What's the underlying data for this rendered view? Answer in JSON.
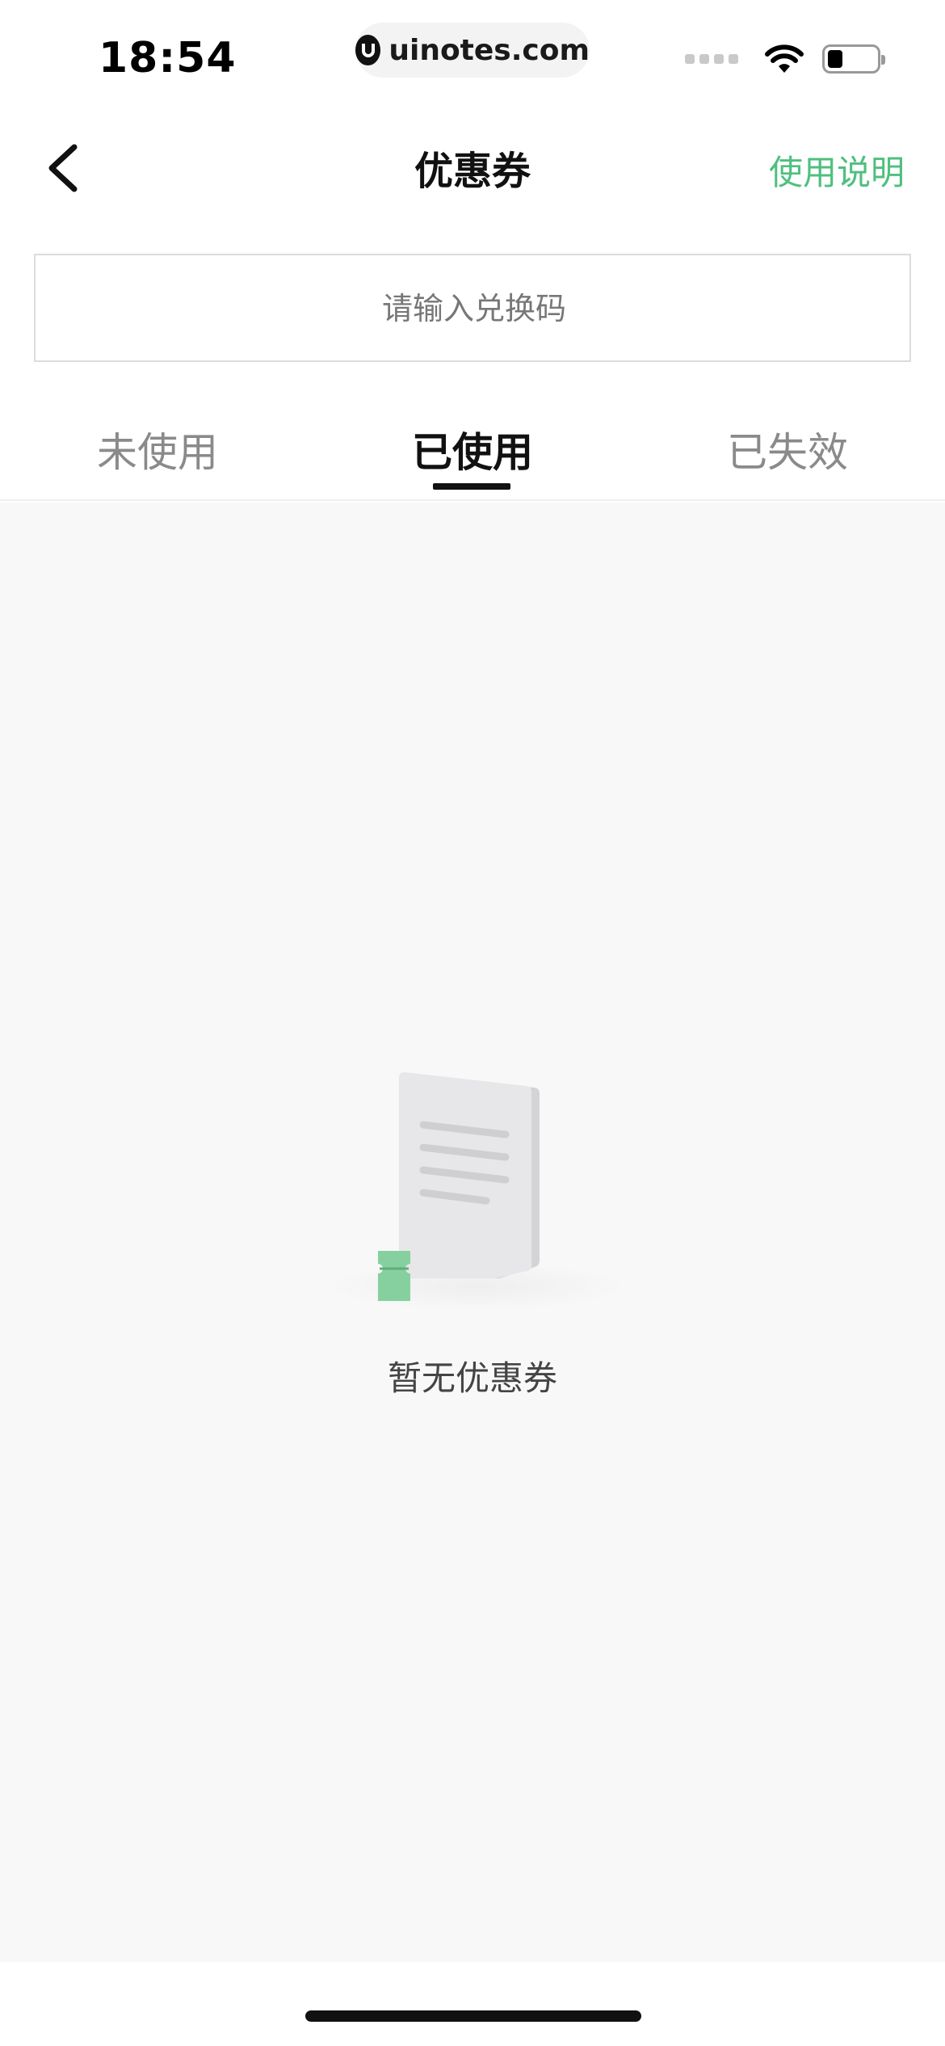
{
  "status_bar": {
    "time": "18:54",
    "url": "uinotes.com",
    "icons": [
      "signal-dots-icon",
      "wifi-icon",
      "battery-icon"
    ]
  },
  "nav": {
    "title": "优惠券",
    "help_label": "使用说明",
    "back_icon": "chevron-left-icon"
  },
  "redeem": {
    "placeholder": "请输入兑换码",
    "value": ""
  },
  "tabs": [
    {
      "label": "未使用",
      "active": false
    },
    {
      "label": "已使用",
      "active": true
    },
    {
      "label": "已失效",
      "active": false
    }
  ],
  "empty_state": {
    "message": "暂无优惠券",
    "icon": "empty-document-icon"
  },
  "colors": {
    "accent": "#4fbf7f",
    "content_bg": "#f8f8f8",
    "ticket_green": "#7fcf9a"
  }
}
